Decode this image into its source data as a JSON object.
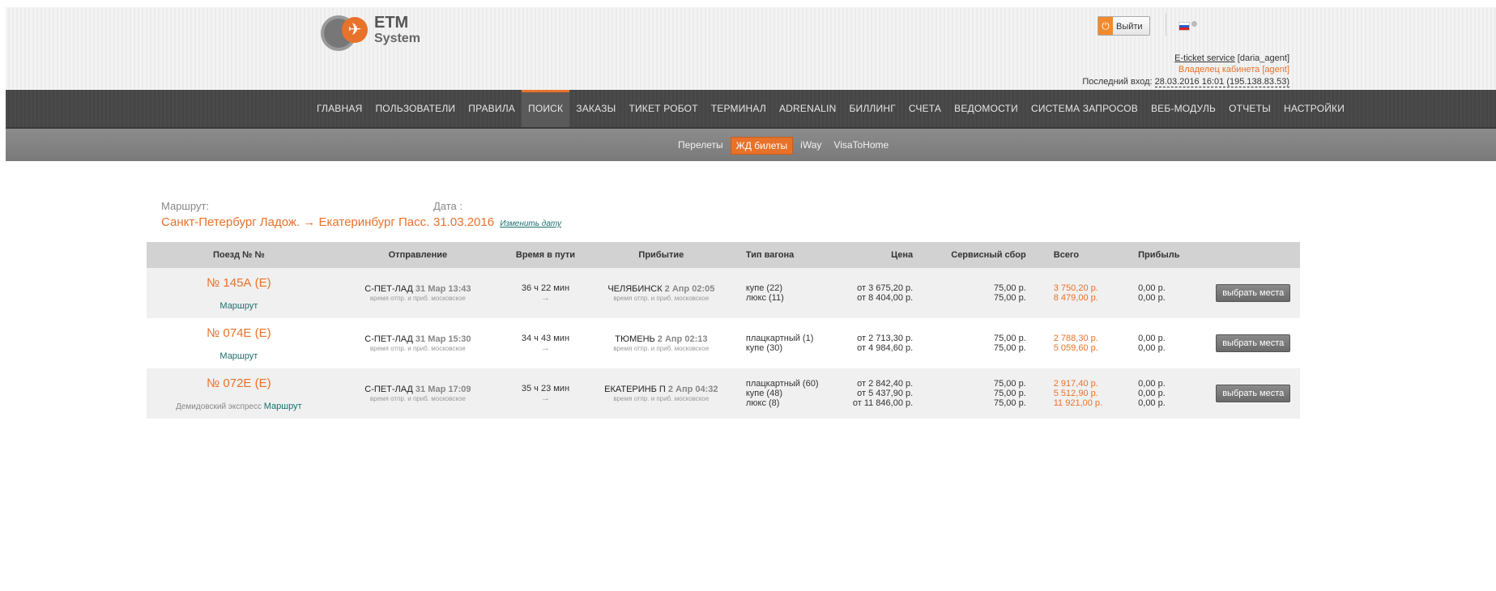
{
  "brand": {
    "line1": "ETM",
    "line2": "System"
  },
  "user": {
    "logout_label": "Выйти",
    "service_link": "E-ticket service",
    "service_user": "[daria_agent]",
    "role": "Владелец кабинета [agent]",
    "last_login_label": "Последний вход:",
    "last_login_value": "28.03.2016 16:01 (195.138.83.53)"
  },
  "nav": {
    "items": [
      "ГЛАВНАЯ",
      "ПОЛЬЗОВАТЕЛИ",
      "ПРАВИЛА",
      "ПОИСК",
      "ЗАКАЗЫ",
      "ТИКЕТ РОБОТ",
      "ТЕРМИНАЛ",
      "ADRENALIN",
      "БИЛЛИНГ",
      "СЧЕТА",
      "ВЕДОМОСТИ",
      "СИСТЕМА ЗАПРОСОВ",
      "ВЕБ-МОДУЛЬ",
      "ОТЧЕТЫ",
      "НАСТРОЙКИ"
    ],
    "active": "ПОИСК"
  },
  "subnav": {
    "items": [
      "Перелеты",
      "ЖД билеты",
      "iWay",
      "VisaToHome"
    ],
    "active": "ЖД билеты"
  },
  "route": {
    "label": "Маршрут:",
    "value": "Санкт-Петербург Ладож. → Екатеринбург Пасс.",
    "date_label": "Дата :",
    "date_value": "31.03.2016",
    "change_date": "Изменить дату"
  },
  "table": {
    "headers": [
      "Поезд № №",
      "Отправление",
      "Время в пути",
      "Прибытие",
      "Тип вагона",
      "Цена",
      "Сервисный сбор",
      "Всего",
      "Прибыль",
      ""
    ],
    "rows": [
      {
        "train": "№ 145А (Е)",
        "train_extra": "",
        "route_link": "Маршрут",
        "dep_station": "С-ПЕТ-ЛАД",
        "dep_time": "31 Мар 13:43",
        "dep_note": "время отпр. и приб. московское",
        "duration": "36 ч 22 мин",
        "arrow": "→",
        "arr_station": "ЧЕЛЯБИНСК",
        "arr_time": "2 Апр 02:05",
        "arr_note": "время отпр. и приб. московское",
        "car_types": [
          "купе (22)",
          "люкс (11)"
        ],
        "prices": [
          "от 3 675,20 р.",
          "от 8 404,00 р."
        ],
        "service": [
          "75,00 р.",
          "75,00 р."
        ],
        "totals": [
          "3 750,20 р.",
          "8 479,00 р."
        ],
        "profits": [
          "0,00 р.",
          "0,00 р."
        ],
        "action": "выбрать места"
      },
      {
        "train": "№ 074Е (Е)",
        "train_extra": "",
        "route_link": "Маршрут",
        "dep_station": "С-ПЕТ-ЛАД",
        "dep_time": "31 Мар 15:30",
        "dep_note": "время отпр. и приб. московское",
        "duration": "34 ч 43 мин",
        "arrow": "→",
        "arr_station": "ТЮМЕНЬ",
        "arr_time": "2 Апр 02:13",
        "arr_note": "время отпр. и приб. московское",
        "car_types": [
          "плацкартный (1)",
          "купе (30)"
        ],
        "prices": [
          "от 2 713,30 р.",
          "от 4 984,60 р."
        ],
        "service": [
          "75,00 р.",
          "75,00 р."
        ],
        "totals": [
          "2 788,30 р.",
          "5 059,60 р."
        ],
        "profits": [
          "0,00 р.",
          "0,00 р."
        ],
        "action": "выбрать места"
      },
      {
        "train": "№ 072Е (Е)",
        "train_extra": "Демидовский экспресс",
        "route_link": "Маршрут",
        "dep_station": "С-ПЕТ-ЛАД",
        "dep_time": "31 Мар 17:09",
        "dep_note": "время отпр. и приб. московское",
        "duration": "35 ч 23 мин",
        "arrow": "→",
        "arr_station": "ЕКАТЕРИНБ П",
        "arr_time": "2 Апр 04:32",
        "arr_note": "время отпр. и приб. московское",
        "car_types": [
          "плацкартный (60)",
          "купе (48)",
          "люкс (8)"
        ],
        "prices": [
          "от 2 842,40 р.",
          "от 5 437,90 р.",
          "от 11 846,00 р."
        ],
        "service": [
          "75,00 р.",
          "75,00 р.",
          "75,00 р."
        ],
        "totals": [
          "2 917,40 р.",
          "5 512,90 р.",
          "11 921,00 р."
        ],
        "profits": [
          "0,00 р.",
          "0,00 р.",
          "0,00 р."
        ],
        "action": "выбрать места"
      }
    ]
  },
  "colors": {
    "accent": "#e8722a",
    "link": "#1b6f6f",
    "nav_bg": "#4a4a4a",
    "subnav_bg": "#808080"
  }
}
